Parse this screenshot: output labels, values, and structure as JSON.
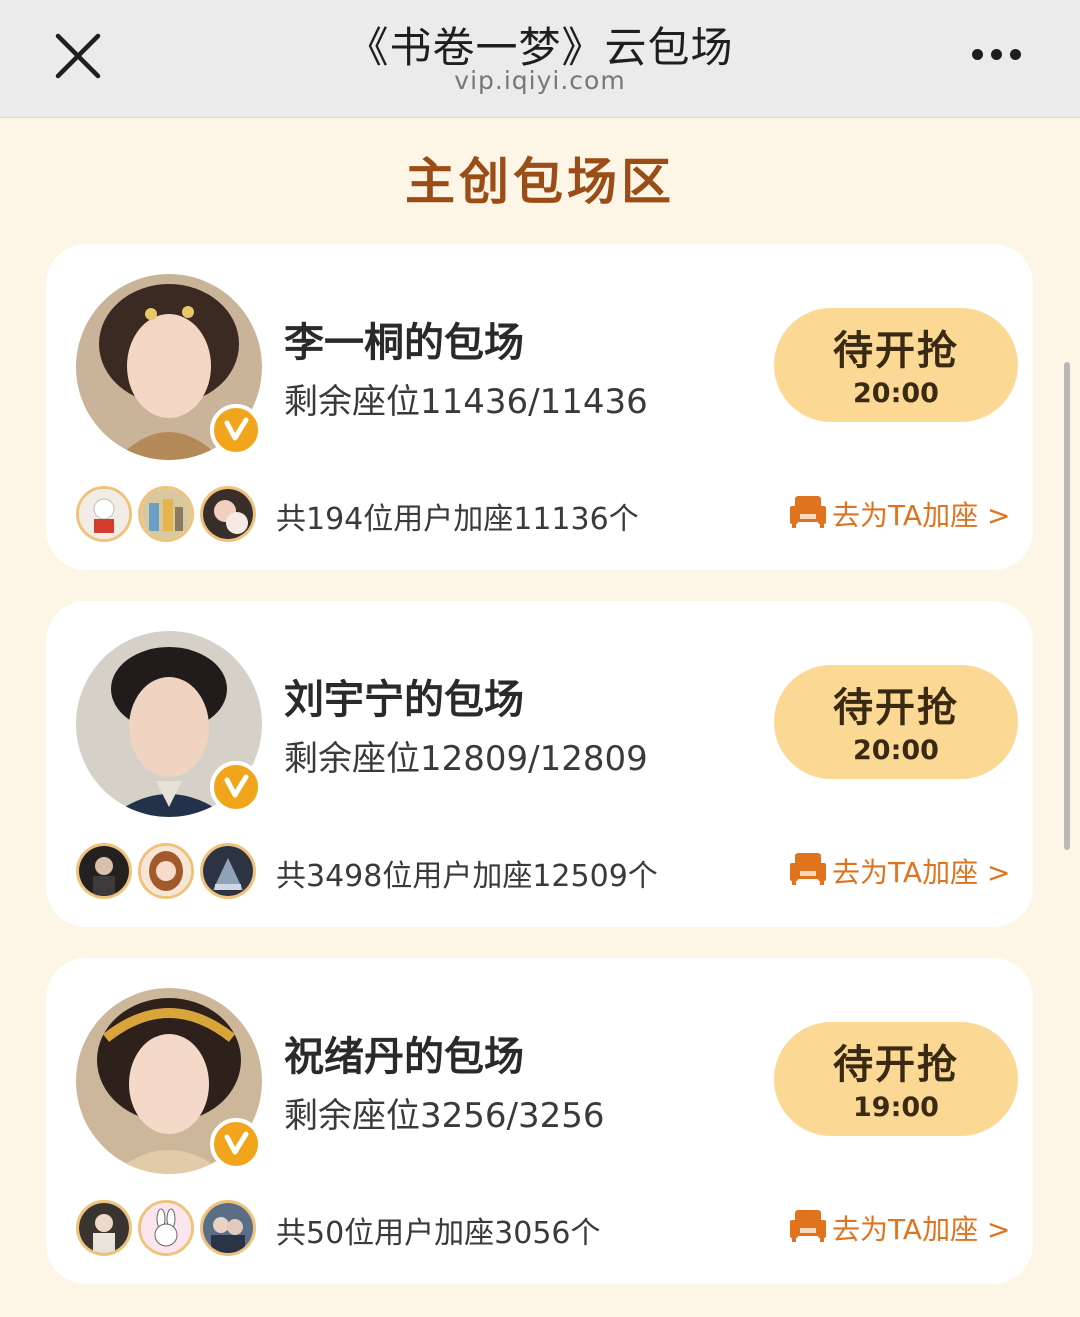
{
  "window": {
    "title": "《书卷一梦》云包场",
    "url": "vip.iqiyi.com"
  },
  "section_title": "主创包场区",
  "cards": [
    {
      "host_name": "李一桐的包场",
      "seats": "剩余座位11436/11436",
      "button_label": "待开抢",
      "button_time": "20:00",
      "users_count": "共194位用户加座11136个",
      "join_label": "去为TA加座 >"
    },
    {
      "host_name": "刘宇宁的包场",
      "seats": "剩余座位12809/12809",
      "button_label": "待开抢",
      "button_time": "20:00",
      "users_count": "共3498位用户加座12509个",
      "join_label": "去为TA加座 >"
    },
    {
      "host_name": "祝绪丹的包场",
      "seats": "剩余座位3256/3256",
      "button_label": "待开抢",
      "button_time": "19:00",
      "users_count": "共50位用户加座3056个",
      "join_label": "去为TA加座 >"
    }
  ],
  "colors": {
    "page_bg": "#fdf6e6",
    "section_title": "#9a4d16",
    "button_bg": "#fbd995",
    "accent_orange": "#e0731e",
    "badge": "#f0a51c"
  },
  "icons": [
    "close-icon",
    "more-icon",
    "vip-badge-icon",
    "sofa-icon"
  ]
}
